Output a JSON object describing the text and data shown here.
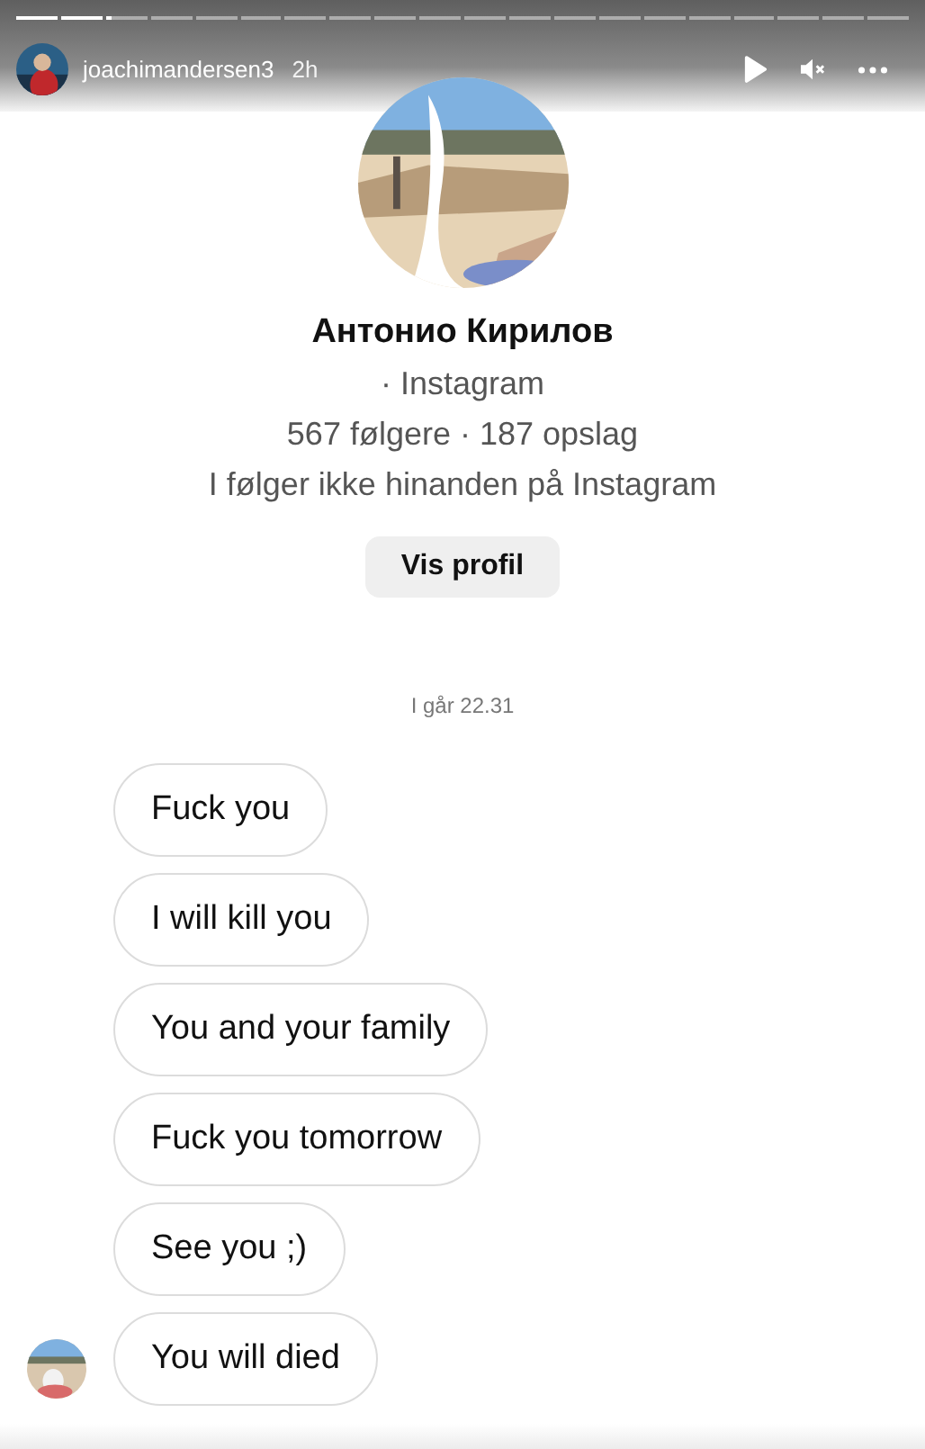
{
  "story_progress": [
    {
      "level": 1
    },
    {
      "level": 1
    },
    {
      "level": 0.15
    },
    {
      "level": 0
    },
    {
      "level": 0
    },
    {
      "level": 0
    },
    {
      "level": 0
    },
    {
      "level": 0
    },
    {
      "level": 0
    },
    {
      "level": 0
    },
    {
      "level": 0
    },
    {
      "level": 0
    },
    {
      "level": 0
    },
    {
      "level": 0
    },
    {
      "level": 0
    },
    {
      "level": 0
    },
    {
      "level": 0
    },
    {
      "level": 0
    },
    {
      "level": 0
    },
    {
      "level": 0
    }
  ],
  "story_header": {
    "username": "joachimandersen3",
    "time": "2h"
  },
  "profile": {
    "name": "Антонио Кирилов",
    "subtitle": "· Instagram",
    "stats": "567 følgere · 187 opslag",
    "relation": "I følger ikke hinanden på Instagram",
    "button": "Vis profil"
  },
  "timestamp": "I går 22.31",
  "messages": [
    {
      "text": "Fuck you",
      "show_avatar": false
    },
    {
      "text": "I will kill you",
      "show_avatar": false
    },
    {
      "text": "You and your family",
      "show_avatar": false
    },
    {
      "text": "Fuck you tomorrow",
      "show_avatar": false
    },
    {
      "text": "See you ;)",
      "show_avatar": false
    },
    {
      "text": "You will died",
      "show_avatar": true
    }
  ]
}
